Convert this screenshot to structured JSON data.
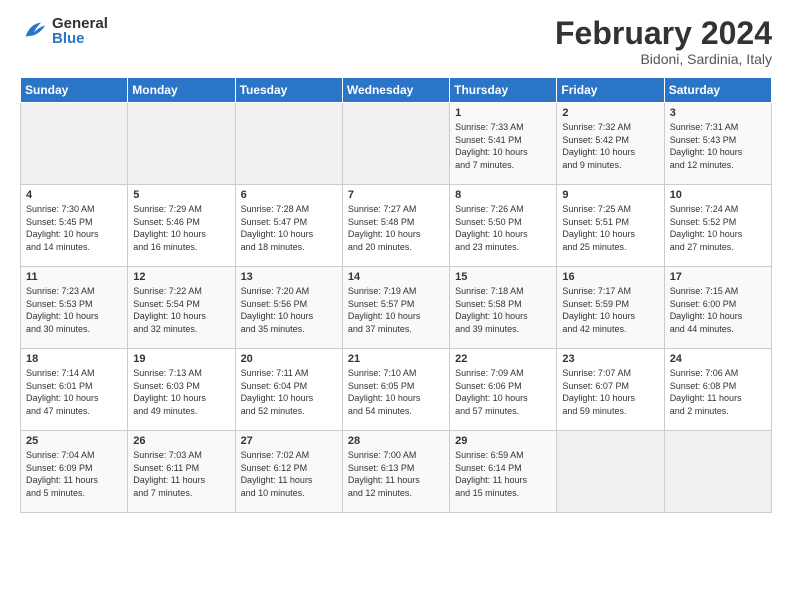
{
  "header": {
    "logo_general": "General",
    "logo_blue": "Blue",
    "month_title": "February 2024",
    "subtitle": "Bidoni, Sardinia, Italy"
  },
  "days_of_week": [
    "Sunday",
    "Monday",
    "Tuesday",
    "Wednesday",
    "Thursday",
    "Friday",
    "Saturday"
  ],
  "weeks": [
    [
      {
        "day": "",
        "info": ""
      },
      {
        "day": "",
        "info": ""
      },
      {
        "day": "",
        "info": ""
      },
      {
        "day": "",
        "info": ""
      },
      {
        "day": "1",
        "info": "Sunrise: 7:33 AM\nSunset: 5:41 PM\nDaylight: 10 hours\nand 7 minutes."
      },
      {
        "day": "2",
        "info": "Sunrise: 7:32 AM\nSunset: 5:42 PM\nDaylight: 10 hours\nand 9 minutes."
      },
      {
        "day": "3",
        "info": "Sunrise: 7:31 AM\nSunset: 5:43 PM\nDaylight: 10 hours\nand 12 minutes."
      }
    ],
    [
      {
        "day": "4",
        "info": "Sunrise: 7:30 AM\nSunset: 5:45 PM\nDaylight: 10 hours\nand 14 minutes."
      },
      {
        "day": "5",
        "info": "Sunrise: 7:29 AM\nSunset: 5:46 PM\nDaylight: 10 hours\nand 16 minutes."
      },
      {
        "day": "6",
        "info": "Sunrise: 7:28 AM\nSunset: 5:47 PM\nDaylight: 10 hours\nand 18 minutes."
      },
      {
        "day": "7",
        "info": "Sunrise: 7:27 AM\nSunset: 5:48 PM\nDaylight: 10 hours\nand 20 minutes."
      },
      {
        "day": "8",
        "info": "Sunrise: 7:26 AM\nSunset: 5:50 PM\nDaylight: 10 hours\nand 23 minutes."
      },
      {
        "day": "9",
        "info": "Sunrise: 7:25 AM\nSunset: 5:51 PM\nDaylight: 10 hours\nand 25 minutes."
      },
      {
        "day": "10",
        "info": "Sunrise: 7:24 AM\nSunset: 5:52 PM\nDaylight: 10 hours\nand 27 minutes."
      }
    ],
    [
      {
        "day": "11",
        "info": "Sunrise: 7:23 AM\nSunset: 5:53 PM\nDaylight: 10 hours\nand 30 minutes."
      },
      {
        "day": "12",
        "info": "Sunrise: 7:22 AM\nSunset: 5:54 PM\nDaylight: 10 hours\nand 32 minutes."
      },
      {
        "day": "13",
        "info": "Sunrise: 7:20 AM\nSunset: 5:56 PM\nDaylight: 10 hours\nand 35 minutes."
      },
      {
        "day": "14",
        "info": "Sunrise: 7:19 AM\nSunset: 5:57 PM\nDaylight: 10 hours\nand 37 minutes."
      },
      {
        "day": "15",
        "info": "Sunrise: 7:18 AM\nSunset: 5:58 PM\nDaylight: 10 hours\nand 39 minutes."
      },
      {
        "day": "16",
        "info": "Sunrise: 7:17 AM\nSunset: 5:59 PM\nDaylight: 10 hours\nand 42 minutes."
      },
      {
        "day": "17",
        "info": "Sunrise: 7:15 AM\nSunset: 6:00 PM\nDaylight: 10 hours\nand 44 minutes."
      }
    ],
    [
      {
        "day": "18",
        "info": "Sunrise: 7:14 AM\nSunset: 6:01 PM\nDaylight: 10 hours\nand 47 minutes."
      },
      {
        "day": "19",
        "info": "Sunrise: 7:13 AM\nSunset: 6:03 PM\nDaylight: 10 hours\nand 49 minutes."
      },
      {
        "day": "20",
        "info": "Sunrise: 7:11 AM\nSunset: 6:04 PM\nDaylight: 10 hours\nand 52 minutes."
      },
      {
        "day": "21",
        "info": "Sunrise: 7:10 AM\nSunset: 6:05 PM\nDaylight: 10 hours\nand 54 minutes."
      },
      {
        "day": "22",
        "info": "Sunrise: 7:09 AM\nSunset: 6:06 PM\nDaylight: 10 hours\nand 57 minutes."
      },
      {
        "day": "23",
        "info": "Sunrise: 7:07 AM\nSunset: 6:07 PM\nDaylight: 10 hours\nand 59 minutes."
      },
      {
        "day": "24",
        "info": "Sunrise: 7:06 AM\nSunset: 6:08 PM\nDaylight: 11 hours\nand 2 minutes."
      }
    ],
    [
      {
        "day": "25",
        "info": "Sunrise: 7:04 AM\nSunset: 6:09 PM\nDaylight: 11 hours\nand 5 minutes."
      },
      {
        "day": "26",
        "info": "Sunrise: 7:03 AM\nSunset: 6:11 PM\nDaylight: 11 hours\nand 7 minutes."
      },
      {
        "day": "27",
        "info": "Sunrise: 7:02 AM\nSunset: 6:12 PM\nDaylight: 11 hours\nand 10 minutes."
      },
      {
        "day": "28",
        "info": "Sunrise: 7:00 AM\nSunset: 6:13 PM\nDaylight: 11 hours\nand 12 minutes."
      },
      {
        "day": "29",
        "info": "Sunrise: 6:59 AM\nSunset: 6:14 PM\nDaylight: 11 hours\nand 15 minutes."
      },
      {
        "day": "",
        "info": ""
      },
      {
        "day": "",
        "info": ""
      }
    ]
  ]
}
